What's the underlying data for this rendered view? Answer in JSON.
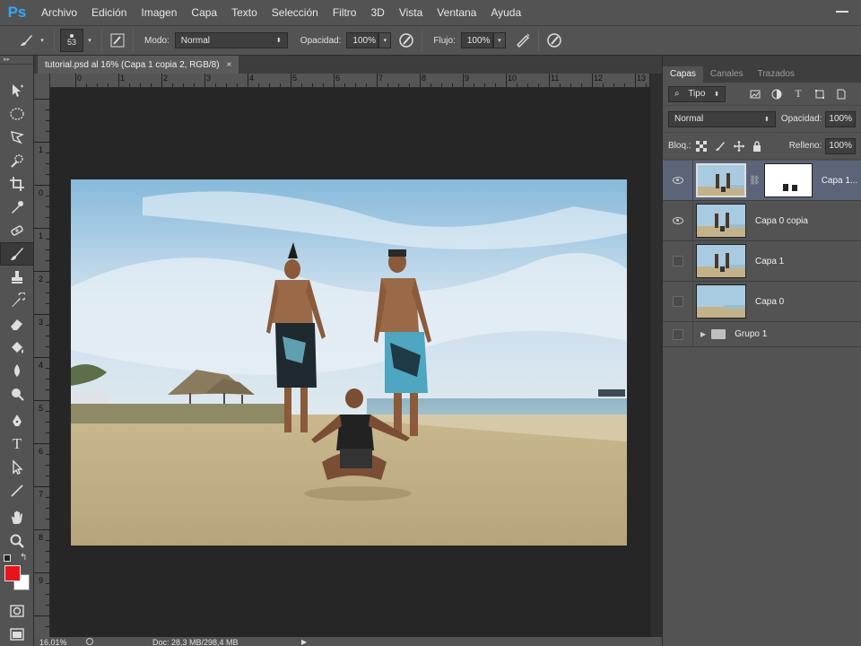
{
  "app": {
    "logo": "Ps"
  },
  "menu": [
    "Archivo",
    "Edición",
    "Imagen",
    "Capa",
    "Texto",
    "Selección",
    "Filtro",
    "3D",
    "Vista",
    "Ventana",
    "Ayuda"
  ],
  "options": {
    "brush_size": "53",
    "mode_label": "Modo:",
    "mode_value": "Normal",
    "opacity_label": "Opacidad:",
    "opacity_value": "100%",
    "flow_label": "Flujo:",
    "flow_value": "100%"
  },
  "document": {
    "tab_title": "tutorial.psd al 16% (Capa 1 copia 2, RGB/8)",
    "close": "×",
    "ruler_top_labels": [
      "0",
      "1",
      "2",
      "3",
      "4",
      "5",
      "6",
      "7",
      "8",
      "9",
      "10",
      "11",
      "12",
      "13"
    ],
    "ruler_left_labels": [
      "1",
      "0",
      "1",
      "2",
      "3",
      "4",
      "5",
      "6",
      "7",
      "8",
      "9"
    ]
  },
  "status": {
    "zoom": "16,01%",
    "doc": "Doc: 28,3 MB/298,4 MB"
  },
  "panel": {
    "tabs": [
      "Capas",
      "Canales",
      "Trazados"
    ],
    "filter_kind": "Tipo",
    "blend_mode": "Normal",
    "opacity_label": "Opacidad:",
    "opacity_value": "100%",
    "lock_label": "Bloq.:",
    "fill_label": "Relleno:",
    "fill_value": "100%"
  },
  "layers": [
    {
      "name": "Capa 1...",
      "visible": true,
      "selected": true,
      "has_mask": true
    },
    {
      "name": "Capa 0 copia",
      "visible": true,
      "selected": false,
      "has_mask": false
    },
    {
      "name": "Capa 1",
      "visible": false,
      "selected": false,
      "has_mask": false
    },
    {
      "name": "Capa 0",
      "visible": false,
      "selected": false,
      "has_mask": false
    }
  ],
  "group": {
    "name": "Grupo 1"
  },
  "colors": {
    "foreground": "#e8141b",
    "background": "#ffffff",
    "ps_blue": "#31a8ff"
  }
}
